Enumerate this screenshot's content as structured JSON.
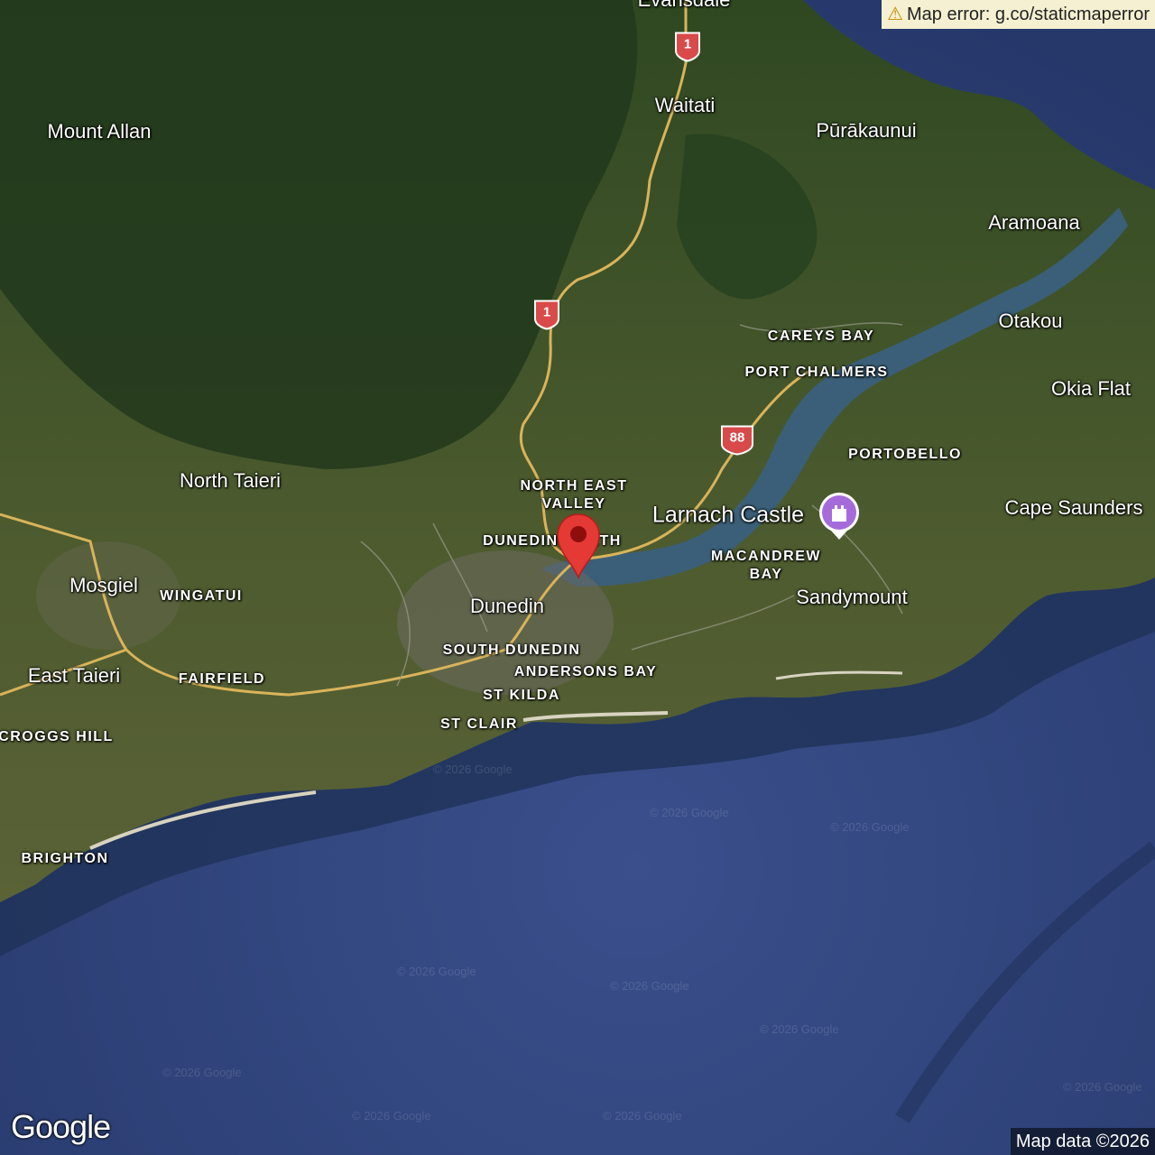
{
  "map": {
    "labels": {
      "waitati": "Waitati",
      "purakaunui": "Pūrākaunui",
      "mount_allan": "Mount Allan",
      "aramoana": "Aramoana",
      "otakou": "Otakou",
      "careys_bay": "CAREYS BAY",
      "port_chalmers": "PORT CHALMERS",
      "okia_flat": "Okia Flat",
      "portobello": "PORTOBELLO",
      "north_taieri": "North Taieri",
      "north_east_valley_1": "NORTH EAST",
      "north_east_valley_2": "VALLEY",
      "cape_saunders": "Cape Saunders",
      "larnach_castle": "Larnach Castle",
      "dunedin_north": "DUNEDIN NORTH",
      "macandrew_bay_1": "MACANDREW",
      "macandrew_bay_2": "BAY",
      "mosgiel": "Mosgiel",
      "wingatui": "WINGATUI",
      "dunedin": "Dunedin",
      "sandymount": "Sandymount",
      "south_dunedin": "SOUTH DUNEDIN",
      "east_taieri": "East Taieri",
      "fairfield": "FAIRFIELD",
      "andersons_bay": "ANDERSONS BAY",
      "st_kilda": "ST KILDA",
      "croggs_hill": "CROGGS HILL",
      "st_clair": "ST CLAIR",
      "brighton": "BRIGHTON",
      "top_cut": "Evansdale"
    },
    "routes": {
      "r1": "1",
      "r88": "88"
    },
    "error_text": "Map error: g.co/staticmaperror",
    "attribution": "Map data ©2026",
    "logo": "Google",
    "watermark": "© 2026 Google",
    "colors": {
      "ocean": "#2f4279",
      "land": "#4a5a2c",
      "forest": "#23391d",
      "road": "#d9b35a",
      "marker": "#e53935",
      "poi": "#a66bdb"
    }
  }
}
